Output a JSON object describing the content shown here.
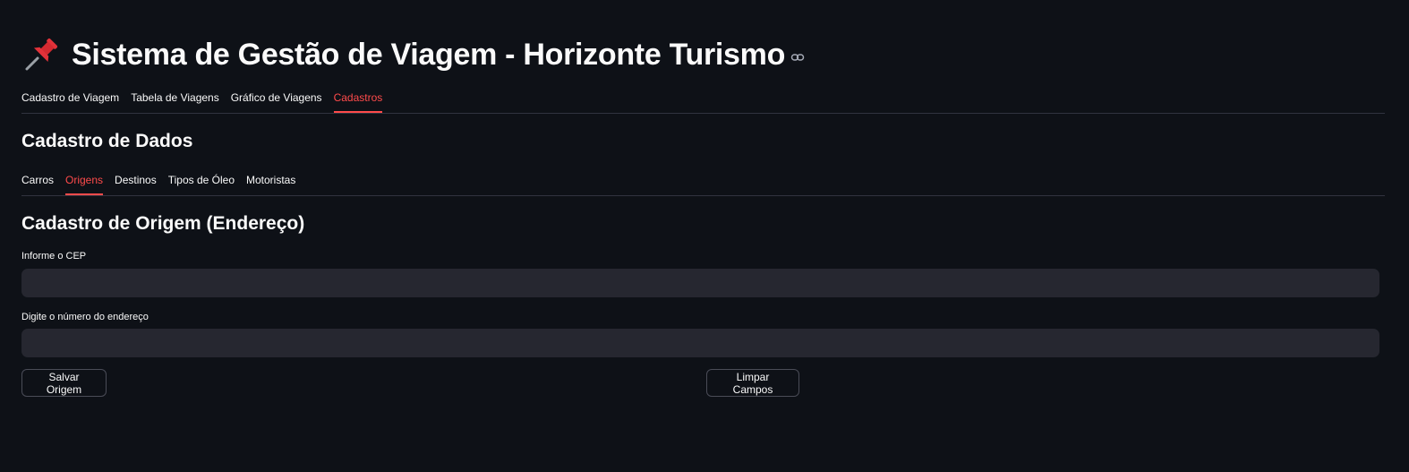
{
  "header": {
    "title": "Sistema de Gestão de Viagem - Horizonte Turismo",
    "icon": "pushpin-icon",
    "anchor_icon": "link-icon"
  },
  "main_tabs": [
    {
      "label": "Cadastro de Viagem",
      "active": false
    },
    {
      "label": "Tabela de Viagens",
      "active": false
    },
    {
      "label": "Gráfico de Viagens",
      "active": false
    },
    {
      "label": "Cadastros",
      "active": true
    }
  ],
  "section": {
    "title": "Cadastro de Dados"
  },
  "sub_tabs": [
    {
      "label": "Carros",
      "active": false
    },
    {
      "label": "Origens",
      "active": true
    },
    {
      "label": "Destinos",
      "active": false
    },
    {
      "label": "Tipos de Óleo",
      "active": false
    },
    {
      "label": "Motoristas",
      "active": false
    }
  ],
  "form": {
    "title": "Cadastro de Origem (Endereço)",
    "cep_label": "Informe o CEP",
    "cep_value": "",
    "number_label": "Digite o número do endereço",
    "number_value": "",
    "save_label": "Salvar Origem",
    "clear_label": "Limpar Campos"
  },
  "colors": {
    "background": "#0e1117",
    "accent": "#ff4b4b",
    "input_bg": "#262730"
  }
}
